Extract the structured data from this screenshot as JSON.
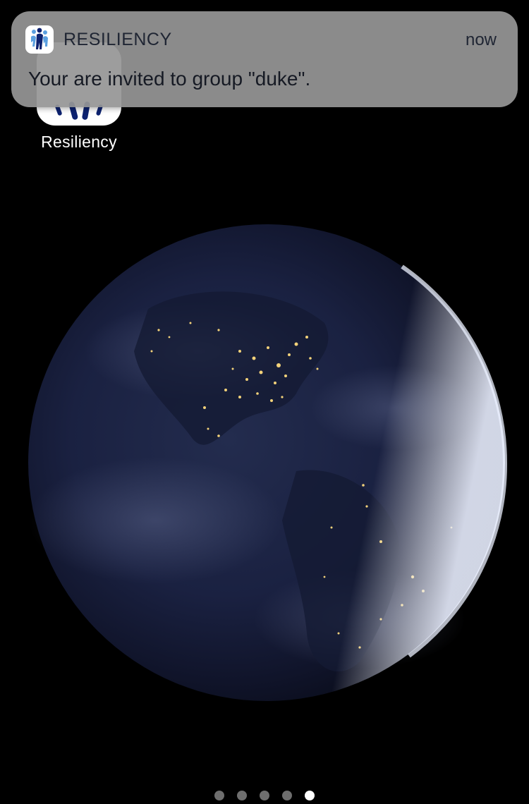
{
  "notification": {
    "app_name": "RESILIENCY",
    "time": "now",
    "message": "Your are invited to group \"duke\"."
  },
  "home_screen": {
    "app_label": "Resiliency",
    "page_count": 5,
    "current_page": 5
  },
  "colors": {
    "icon_blue_dark": "#0d2270",
    "icon_blue_light": "#5a9fe0",
    "banner_bg": "#969696"
  },
  "icons": {
    "app_icon": "people-group-icon",
    "wallpaper": "earth-at-night"
  }
}
